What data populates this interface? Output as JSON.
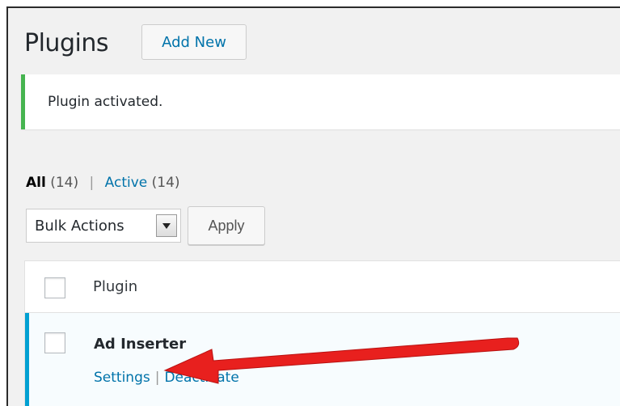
{
  "page": {
    "title": "Plugins",
    "add_new_label": "Add New"
  },
  "notice": {
    "message": "Plugin activated.",
    "accent_color": "#46b450"
  },
  "filters": {
    "all_label": "All",
    "all_count": "(14)",
    "separator": "|",
    "active_label": "Active",
    "active_count": "(14)"
  },
  "bulk_actions": {
    "selected": "Bulk Actions",
    "apply_label": "Apply"
  },
  "table": {
    "column_header": "Plugin",
    "rows": [
      {
        "name": "Ad Inserter",
        "actions": [
          "Settings",
          "Deactivate"
        ],
        "accent_color": "#00a0d2"
      }
    ]
  },
  "annotation": {
    "arrow_color": "#e8201e",
    "icon": "red-arrow-pointing-left"
  }
}
